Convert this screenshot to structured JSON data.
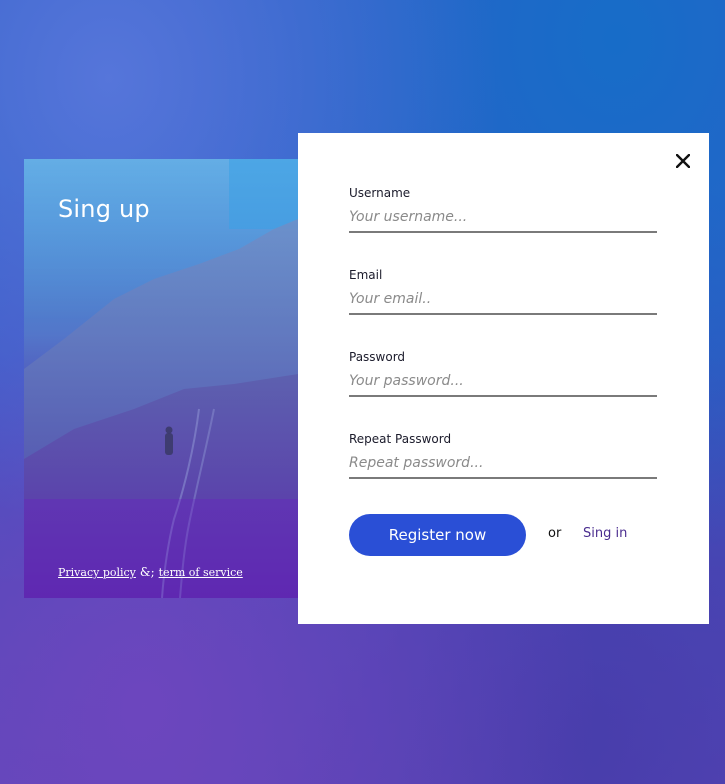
{
  "panel": {
    "title": "Sing up",
    "footer": {
      "privacy_link": "Privacy policy",
      "separator": "&;",
      "terms_link": "term of service"
    }
  },
  "form": {
    "close_icon": "close-icon",
    "fields": [
      {
        "label": "Username",
        "placeholder": "Your username..."
      },
      {
        "label": "Email",
        "placeholder": "Your email.."
      },
      {
        "label": "Password",
        "placeholder": "Your password..."
      },
      {
        "label": "Repeat Password",
        "placeholder": "Repeat password..."
      }
    ],
    "register_label": "Register now",
    "or_text": "or",
    "signin_link": "Sing in"
  },
  "colors": {
    "accent": "#2a4fd6",
    "link": "#4a2d8f"
  }
}
